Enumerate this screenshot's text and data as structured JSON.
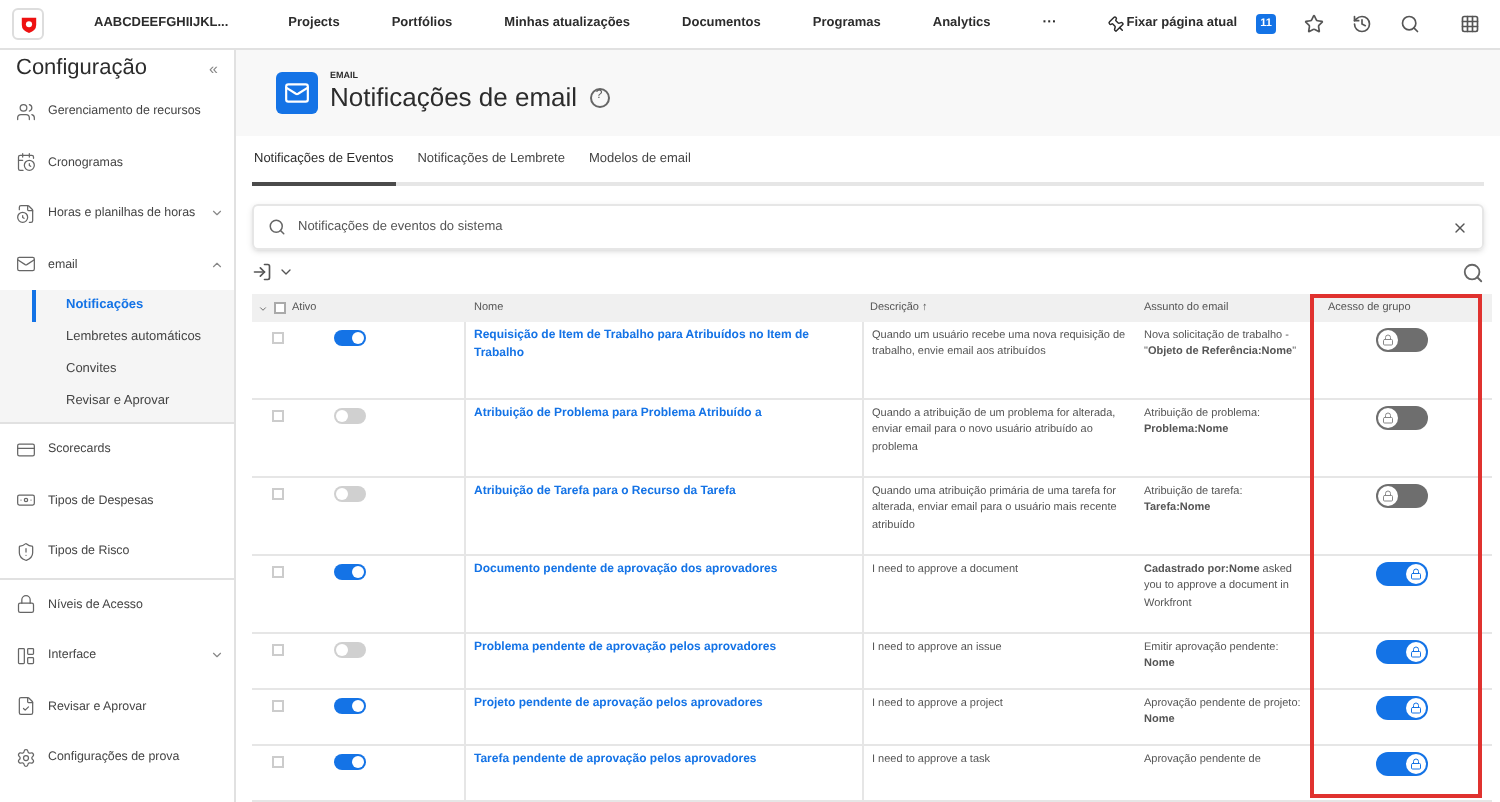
{
  "top_nav": {
    "org": "AABCDEEFGHIIJKL...",
    "items": [
      "Projects",
      "Portfólios",
      "Minhas atualizações",
      "Documentos",
      "Programas",
      "Analytics"
    ],
    "more": "···",
    "pin": "Fixar página atual",
    "badge": "11"
  },
  "sidebar": {
    "title": "Configuração",
    "collapse": "«",
    "items": [
      {
        "label": "Gerenciamento de recursos"
      },
      {
        "label": "Cronogramas"
      },
      {
        "label": "Horas e planilhas de horas",
        "expanded": false
      },
      {
        "label": "email",
        "expanded": true,
        "children": [
          {
            "label": "Notificações",
            "selected": true
          },
          {
            "label": "Lembretes automáticos",
            "selected": false
          },
          {
            "label": "Convites",
            "selected": false
          },
          {
            "label": "Revisar e Aprovar",
            "selected": false
          }
        ]
      },
      {
        "label": "Scorecards"
      },
      {
        "label": "Tipos de Despesas"
      },
      {
        "label": "Tipos de Risco"
      },
      {
        "label": "Níveis de Acesso"
      },
      {
        "label": "Interface",
        "expanded": false
      },
      {
        "label": "Revisar e Aprovar"
      },
      {
        "label": "Configurações de prova"
      }
    ]
  },
  "header": {
    "eyebrow": "EMAIL",
    "title": "Notificações de email",
    "help": "?"
  },
  "tabs": [
    {
      "label": "Notificações de Eventos",
      "selected": true
    },
    {
      "label": "Notificações de Lembrete",
      "selected": false
    },
    {
      "label": "Modelos de email",
      "selected": false
    }
  ],
  "search": {
    "value": "Notificações de eventos do sistema"
  },
  "table": {
    "select_all": false,
    "columns": [
      "Ativo",
      "Nome",
      "Descrição ↑",
      "Assunto do email",
      "Acesso de grupo"
    ],
    "rows": [
      {
        "checked": false,
        "active": true,
        "name": "Requisição de Item de Trabalho para Atribuídos no Item de Trabalho",
        "description": "Quando um usuário recebe uma nova requisição de trabalho, envie email aos atribuídos",
        "subject": "Nova solicitação de trabalho - \"**Objeto de Referência:Nome**\"",
        "group_access": false
      },
      {
        "checked": false,
        "active": false,
        "name": "Atribuição de Problema para Problema Atribuído a",
        "description": "Quando a atribuição de um problema for alterada, enviar email para o novo usuário atribuído ao problema",
        "subject": "Atribuição de problema: **Problema:Nome**",
        "group_access": false
      },
      {
        "checked": false,
        "active": false,
        "name": "Atribuição de Tarefa para o Recurso da Tarefa",
        "description": "Quando uma atribuição primária de uma tarefa for alterada, enviar email para o usuário mais recente atribuído",
        "subject": "Atribuição de tarefa: **Tarefa:Nome**",
        "group_access": false
      },
      {
        "checked": false,
        "active": true,
        "name": "Documento pendente de aprovação dos aprovadores",
        "description": "I need to approve a document",
        "subject": "**Cadastrado por:Nome** asked you to approve a document in Workfront",
        "group_access": true
      },
      {
        "checked": false,
        "active": false,
        "name": "Problema pendente de aprovação pelos aprovadores",
        "description": "I need to approve an issue",
        "subject": "Emitir aprovação pendente: **Nome**",
        "group_access": true
      },
      {
        "checked": false,
        "active": true,
        "name": "Projeto pendente de aprovação pelos aprovadores",
        "description": "I need to approve a project",
        "subject": "Aprovação pendente de projeto: **Nome**",
        "group_access": true
      },
      {
        "checked": false,
        "active": true,
        "name": "Tarefa pendente de aprovação pelos aprovadores",
        "description": "I need to approve a task",
        "subject": "Aprovação pendente de",
        "group_access": true
      }
    ]
  }
}
